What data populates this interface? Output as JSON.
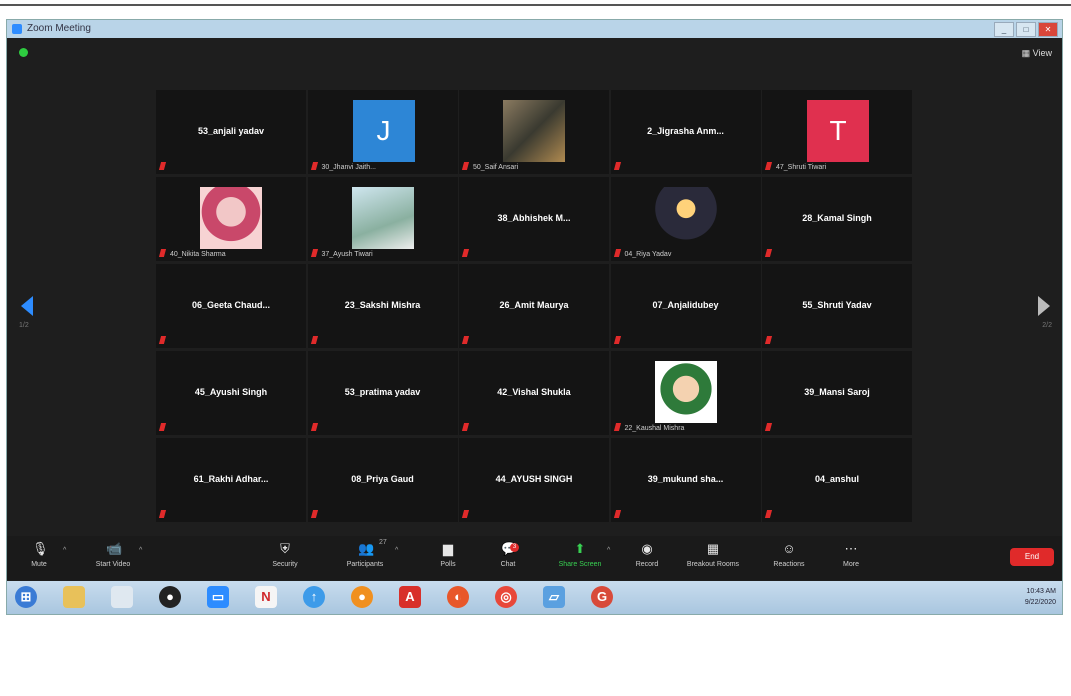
{
  "window": {
    "title": "Zoom Meeting",
    "view_label": "View"
  },
  "participants": [
    {
      "name": "53_anjali yadav",
      "kind": "name"
    },
    {
      "name": "30_Jhanvi Jaith...",
      "kind": "avatar",
      "initial": "J",
      "color": "#2d86d6"
    },
    {
      "name": "50_Saif Ansari",
      "kind": "photo"
    },
    {
      "name": "2_Jigrasha Anm...",
      "kind": "name"
    },
    {
      "name": "47_Shruti Tiwari",
      "kind": "avatar",
      "initial": "T",
      "color": "#e0304f"
    },
    {
      "name": "40_Nikita Sharma",
      "kind": "photo"
    },
    {
      "name": "37_Ayush Tiwari",
      "kind": "photo"
    },
    {
      "name": "38_Abhishek M...",
      "kind": "name"
    },
    {
      "name": "04_Riya Yadav",
      "kind": "photo"
    },
    {
      "name": "28_Kamal Singh",
      "kind": "name"
    },
    {
      "name": "06_Geeta Chaud...",
      "kind": "name"
    },
    {
      "name": "23_Sakshi Mishra",
      "kind": "name"
    },
    {
      "name": "26_Amit Maurya",
      "kind": "name"
    },
    {
      "name": "07_Anjalidubey",
      "kind": "name"
    },
    {
      "name": "55_Shruti Yadav",
      "kind": "name"
    },
    {
      "name": "45_Ayushi Singh",
      "kind": "name"
    },
    {
      "name": "53_pratima yadav",
      "kind": "name"
    },
    {
      "name": "42_Vishal Shukla",
      "kind": "name"
    },
    {
      "name": "22_Kaushal Mishra",
      "kind": "photo"
    },
    {
      "name": "39_Mansi Saroj",
      "kind": "name"
    },
    {
      "name": "61_Rakhi Adhar...",
      "kind": "name"
    },
    {
      "name": "08_Priya Gaud",
      "kind": "name"
    },
    {
      "name": "44_AYUSH SINGH",
      "kind": "name"
    },
    {
      "name": "39_mukund sha...",
      "kind": "name"
    },
    {
      "name": "04_anshul",
      "kind": "name"
    }
  ],
  "pager": {
    "left": "1/2",
    "right": "2/2"
  },
  "toolbar": {
    "mute": "Mute",
    "start_video": "Start Video",
    "security": "Security",
    "participants": "Participants",
    "participants_count": "27",
    "polls": "Polls",
    "chat": "Chat",
    "chat_badge": "3",
    "share_screen": "Share Screen",
    "record": "Record",
    "breakout_rooms": "Breakout Rooms",
    "reactions": "Reactions",
    "more": "More",
    "end": "End"
  },
  "taskbar": {
    "time": "10:43 AM",
    "date": "9/22/2020"
  },
  "colors": {
    "accent": "#2d8cff",
    "end": "#e02a2a",
    "share": "#38d052"
  }
}
